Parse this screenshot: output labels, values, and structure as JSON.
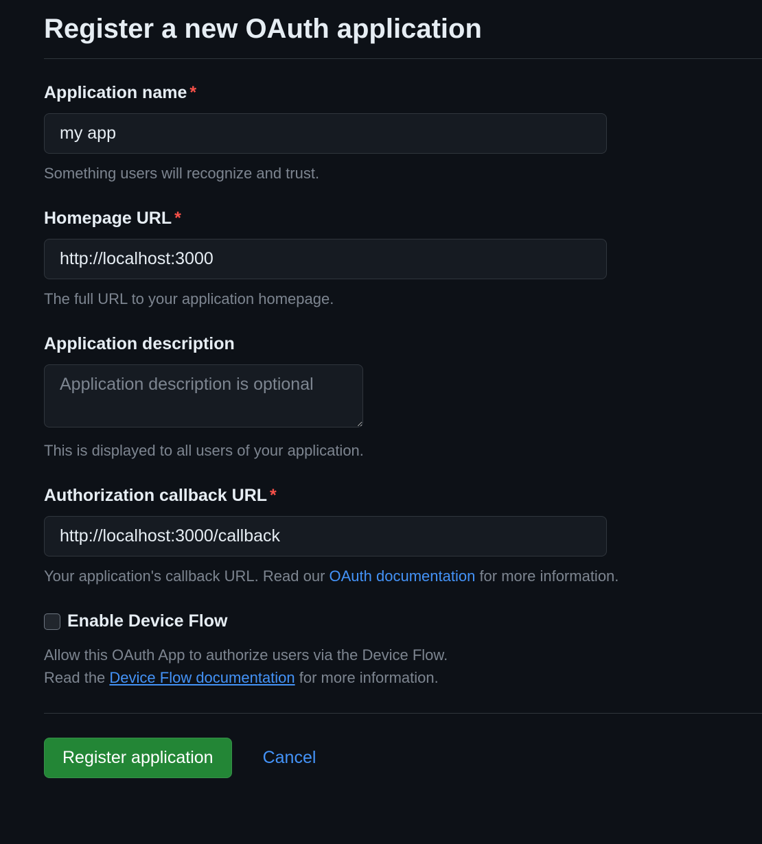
{
  "title": "Register a new OAuth application",
  "fields": {
    "app_name": {
      "label": "Application name",
      "required_marker": "*",
      "value": "my app",
      "help": "Something users will recognize and trust."
    },
    "homepage_url": {
      "label": "Homepage URL",
      "required_marker": "*",
      "value": "http://localhost:3000",
      "help": "The full URL to your application homepage."
    },
    "description": {
      "label": "Application description",
      "placeholder": "Application description is optional",
      "help": "This is displayed to all users of your application."
    },
    "callback_url": {
      "label": "Authorization callback URL",
      "required_marker": "*",
      "value": "http://localhost:3000/callback",
      "help_prefix": "Your application's callback URL. Read our ",
      "help_link": "OAuth documentation",
      "help_suffix": " for more information."
    },
    "device_flow": {
      "label": "Enable Device Flow",
      "help_line1": "Allow this OAuth App to authorize users via the Device Flow.",
      "help_line2_prefix": "Read the ",
      "help_line2_link": "Device Flow documentation",
      "help_line2_suffix": " for more information."
    }
  },
  "actions": {
    "submit": "Register application",
    "cancel": "Cancel"
  }
}
